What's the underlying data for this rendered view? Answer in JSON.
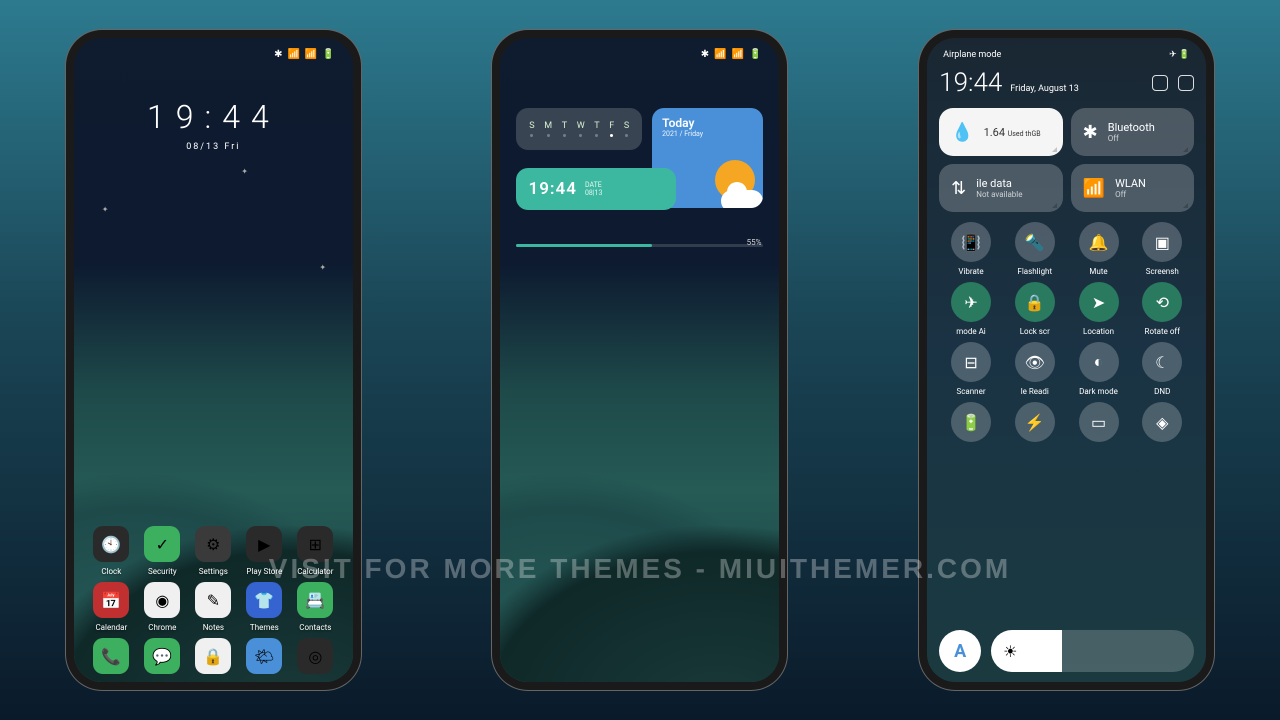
{
  "watermark": "VISIT FOR MORE THEMES - MIUITHEMER.COM",
  "statusbar": {
    "icons": [
      "✱",
      "📶",
      "📶",
      "📡",
      "🔋"
    ]
  },
  "phone1": {
    "clock_time": "19:44",
    "clock_date": "08/13 Fri",
    "row1": [
      {
        "label": "Clock",
        "icon": "🕙",
        "bg": "#2a2a2a"
      },
      {
        "label": "Security",
        "icon": "✓",
        "bg": "#3db060"
      },
      {
        "label": "Settings",
        "icon": "⚙",
        "bg": "#3a3a3a"
      },
      {
        "label": "Play Store",
        "icon": "▶",
        "bg": "#2a2a2a"
      },
      {
        "label": "Calculator",
        "icon": "⊞",
        "bg": "#2a2a2a"
      }
    ],
    "row2": [
      {
        "label": "Calendar",
        "icon": "📅",
        "bg": "#c03030"
      },
      {
        "label": "Chrome",
        "icon": "◉",
        "bg": "#f0f0f0"
      },
      {
        "label": "Notes",
        "icon": "✎",
        "bg": "#f0f0f0"
      },
      {
        "label": "Themes",
        "icon": "👕",
        "bg": "#3563d0"
      },
      {
        "label": "Contacts",
        "icon": "📇",
        "bg": "#3db060"
      }
    ],
    "row3": [
      {
        "label": "",
        "icon": "📞",
        "bg": "#3db060"
      },
      {
        "label": "",
        "icon": "💬",
        "bg": "#3db060"
      },
      {
        "label": "",
        "icon": "🔒",
        "bg": "#f0f0f0"
      },
      {
        "label": "",
        "icon": "🌤",
        "bg": "#4a90d9"
      },
      {
        "label": "",
        "icon": "◎",
        "bg": "#2a2a2a"
      }
    ]
  },
  "phone2": {
    "week": [
      "S",
      "M",
      "T",
      "W",
      "T",
      "F",
      "S"
    ],
    "week_active": 5,
    "today_title": "Today",
    "today_date": "2021 / Friday",
    "time": "19:44",
    "time_sub1": "DATE",
    "time_sub2": "08|13",
    "prog_pct_label": "55%"
  },
  "phone3": {
    "airplane_label": "Airplane mode",
    "time": "19:44",
    "date": "Friday, August 13",
    "tiles": [
      {
        "title": "1.64",
        "sub": "GB",
        "sup": "Used th",
        "style": "white",
        "icon": "💧"
      },
      {
        "title": "Bluetooth",
        "sub": "Off",
        "style": "dark",
        "icon": "✱"
      },
      {
        "title": "ile data",
        "sub": "Not available",
        "style": "dark",
        "icon": "⇅"
      },
      {
        "title": "WLAN",
        "sub": "Off",
        "style": "dark",
        "icon": "📶"
      }
    ],
    "toggles": [
      {
        "label": "Vibrate",
        "icon": "📳",
        "on": false
      },
      {
        "label": "Flashlight",
        "icon": "🔦",
        "on": false
      },
      {
        "label": "Mute",
        "icon": "🔔",
        "on": false
      },
      {
        "label": "Screensh",
        "icon": "▣",
        "on": false
      },
      {
        "label": "mode   Ai",
        "icon": "✈",
        "on": true
      },
      {
        "label": "Lock scr",
        "icon": "🔒",
        "on": true
      },
      {
        "label": "Location",
        "icon": "➤",
        "on": true
      },
      {
        "label": "Rotate off",
        "icon": "⟲",
        "on": true
      },
      {
        "label": "Scanner",
        "icon": "⊟",
        "on": false
      },
      {
        "label": "le   Readi",
        "icon": "👁",
        "on": false
      },
      {
        "label": "Dark mode",
        "icon": "◐",
        "on": false
      },
      {
        "label": "DND",
        "icon": "☾",
        "on": false
      },
      {
        "label": "",
        "icon": "🔋",
        "on": false
      },
      {
        "label": "",
        "icon": "⚡",
        "on": false
      },
      {
        "label": "",
        "icon": "▭",
        "on": false
      },
      {
        "label": "",
        "icon": "◈",
        "on": false
      }
    ],
    "auto_label": "A",
    "bright_icon": "☀"
  }
}
